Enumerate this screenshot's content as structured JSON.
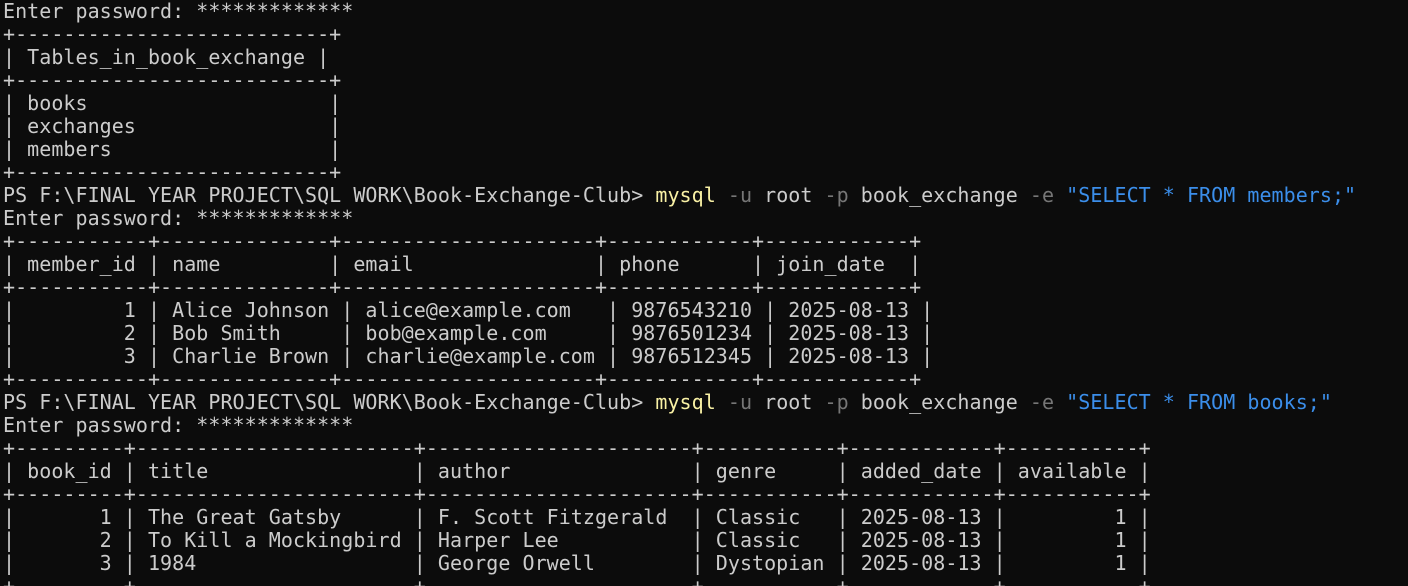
{
  "terminal": {
    "colors": {
      "background": "#0c0c0c",
      "foreground": "#cccccc",
      "command": "#f9f1a5",
      "flag": "#767676",
      "string": "#3b8eea"
    },
    "password_prompt": "Enter password: *************",
    "tables_block": {
      "border": "+--------------------------+",
      "header": "| Tables_in_book_exchange |",
      "rows": [
        "| books                    |",
        "| exchanges                |",
        "| members                  |"
      ]
    },
    "members_command": {
      "prompt": "PS F:\\FINAL YEAR PROJECT\\SQL WORK\\Book-Exchange-Club> ",
      "exe": "mysql",
      "flag_u": " -u",
      "user": " root",
      "flag_p": " -p",
      "database": " book_exchange",
      "flag_e": " -e",
      "query": " \"SELECT * FROM members;\""
    },
    "members_block": {
      "border": "+-----------+--------------+---------------------+------------+------------+",
      "header": "| member_id | name         | email               | phone      | join_date  |",
      "rows": [
        "|         1 | Alice Johnson | alice@example.com   | 9876543210 | 2025-08-13 |",
        "|         2 | Bob Smith     | bob@example.com     | 9876501234 | 2025-08-13 |",
        "|         3 | Charlie Brown | charlie@example.com | 9876512345 | 2025-08-13 |"
      ]
    },
    "books_command": {
      "prompt": "PS F:\\FINAL YEAR PROJECT\\SQL WORK\\Book-Exchange-Club> ",
      "exe": "mysql",
      "flag_u": " -u",
      "user": " root",
      "flag_p": " -p",
      "database": " book_exchange",
      "flag_e": " -e",
      "query": " \"SELECT * FROM books;\""
    },
    "books_block": {
      "border": "+---------+-----------------------+----------------------+-----------+------------+-----------+",
      "header": "| book_id | title                 | author               | genre     | added_date | available |",
      "rows": [
        "|       1 | The Great Gatsby      | F. Scott Fitzgerald  | Classic   | 2025-08-13 |         1 |",
        "|       2 | To Kill a Mockingbird | Harper Lee           | Classic   | 2025-08-13 |         1 |",
        "|       3 | 1984                  | George Orwell        | Dystopian | 2025-08-13 |         1 |"
      ]
    }
  }
}
